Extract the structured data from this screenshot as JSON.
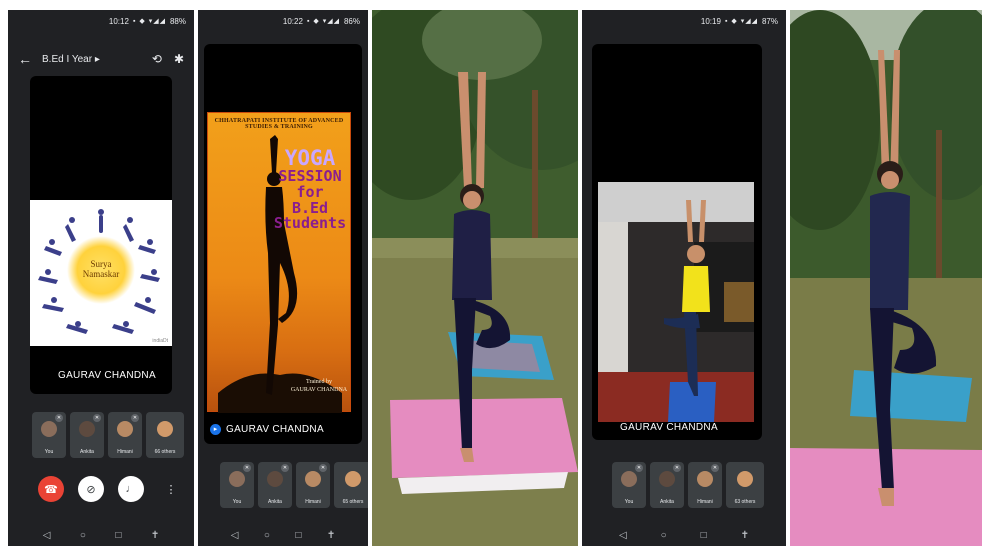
{
  "panel1": {
    "status_time": "10:12",
    "status_battery": "88%",
    "meeting_title": "B.Ed I Year ▸",
    "slide_center_text": "Surya\nNamaskar",
    "slide_credit": "indiaDt",
    "presenter": "GAURAV CHANDNA",
    "participants": [
      "You",
      "Ankita",
      "Himani",
      "66 others"
    ]
  },
  "panel2": {
    "status_time": "10:22",
    "status_battery": "86%",
    "poster": {
      "header": "CHHATRAPATI INSTITUTE OF ADVANCED STUDIES & TRAINING",
      "title_line1": "YOGA",
      "title_line2": "SESSION",
      "title_line3": "for",
      "title_line4": "B.Ed",
      "title_line5": "Students",
      "trained_line1": "Trained by",
      "trained_line2": "GAURAV CHANDNA"
    },
    "presenter": "GAURAV CHANDNA",
    "participants": [
      "You",
      "Ankita",
      "Himani",
      "65 others"
    ]
  },
  "panel4": {
    "status_time": "10:19",
    "status_battery": "87%",
    "presenter": "GAURAV CHANDNA",
    "participants": [
      "You",
      "Ankita",
      "Himani",
      "63 others"
    ]
  },
  "colors": {
    "meet_bg": "#202124",
    "tile_bg": "#3c4043",
    "end_call_red": "#ea4335",
    "poster_orange": "#ec8a16",
    "poster_purple": "#8a1e8f",
    "yoga_mat_pink": "#e58cc0",
    "yoga_mat_blue": "#3aa0c9"
  },
  "icons": {
    "back": "arrow-left-icon",
    "switch_camera": "switch-camera-icon",
    "bluetooth": "bluetooth-icon",
    "end_call": "phone-hangup-icon",
    "camera_off": "camera-off-icon",
    "mic_off": "mic-off-icon",
    "more": "more-vert-icon",
    "nav_back": "nav-back-icon",
    "nav_home": "nav-home-icon",
    "nav_recents": "nav-recents-icon",
    "nav_accessibility": "accessibility-icon"
  }
}
